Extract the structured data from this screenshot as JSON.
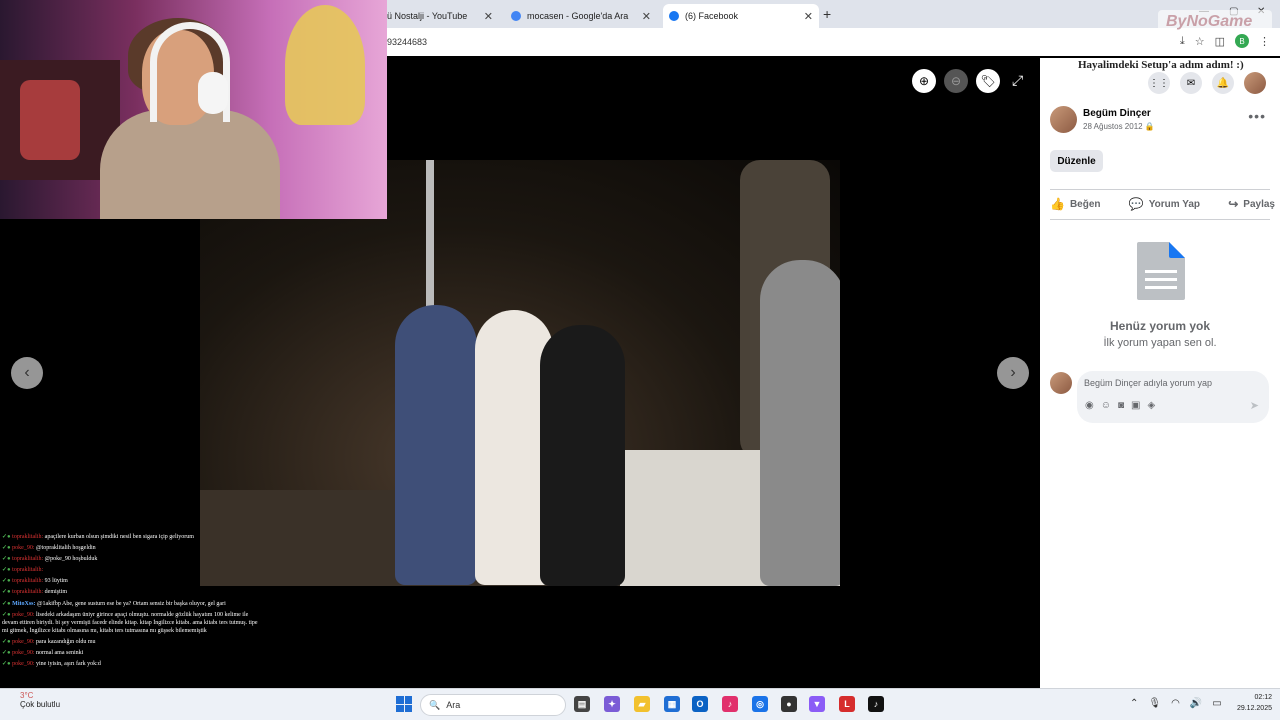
{
  "browser": {
    "tabs": [
      {
        "label": "ü Nostalji - YouTube",
        "favicon_color": "#ff0000"
      },
      {
        "label": "mocasen - Google'da Ara",
        "favicon_color": "#4285f4"
      },
      {
        "label": "(6) Facebook",
        "favicon_color": "#1877f2"
      }
    ],
    "address_text": "93244683"
  },
  "overlay": {
    "title": "Hayalimdeki Setup'a adım adım! :)",
    "watermark": "ByNoGame"
  },
  "post": {
    "author": "Begüm Dinçer",
    "date": "28 Ağustos 2012",
    "edit_label": "Düzenle",
    "actions": {
      "like": "Beğen",
      "comment": "Yorum Yap",
      "share": "Paylaş"
    },
    "empty_title": "Henüz yorum yok",
    "empty_sub": "İlk yorum yapan sen ol.",
    "comment_placeholder": "Begüm Dinçer adıyla yorum yap"
  },
  "chat": [
    {
      "user": "topraklitalih:",
      "text": "apaçilere kurban olsun şimdiki nesil ben sigara içip geliyorum"
    },
    {
      "user": "poke_90:",
      "text": "@topraklitalih hoşgeldin"
    },
    {
      "user": "topraklitalih:",
      "text": "@poke_90 hoşbulduk"
    },
    {
      "user": "topraklitalih:",
      "text": ""
    },
    {
      "user": "topraklitalih:",
      "text": "93 lüytim"
    },
    {
      "user": "topraklitalih:",
      "text": "demiştim"
    },
    {
      "user": "MitoXss:",
      "text": "@1akifbp Abe, gene susturn ese be ya? Ortam sensiz bir başka oluyor, gel gari"
    },
    {
      "user": "poke_90:",
      "text": "lisedeki arkadaşım üniyr girince apaçi olmuştu. normalde gözlük hayatım 100 kelime ile devam ettiren biriydi. bi şey vermişti facedr elinde kitap. kitap İngilizce kitabı. ama kitabı ters tutmuş. tipe mi gitmek, İngilizce kitabı olmasına mı, kitabı ters tutmasına mı güşsek bilememiştik"
    },
    {
      "user": "poke_90:",
      "text": "para kazandığın oldu mu"
    },
    {
      "user": "poke_90:",
      "text": "normal ama seninki"
    },
    {
      "user": "poke_90:",
      "text": "yine iyisin, aşırı fark yok:d"
    }
  ],
  "taskbar": {
    "weather_temp": "3°C",
    "weather_text": "Çok bulutlu",
    "search_label": "Ara",
    "time": "02:12",
    "date": "29.12.2025"
  }
}
